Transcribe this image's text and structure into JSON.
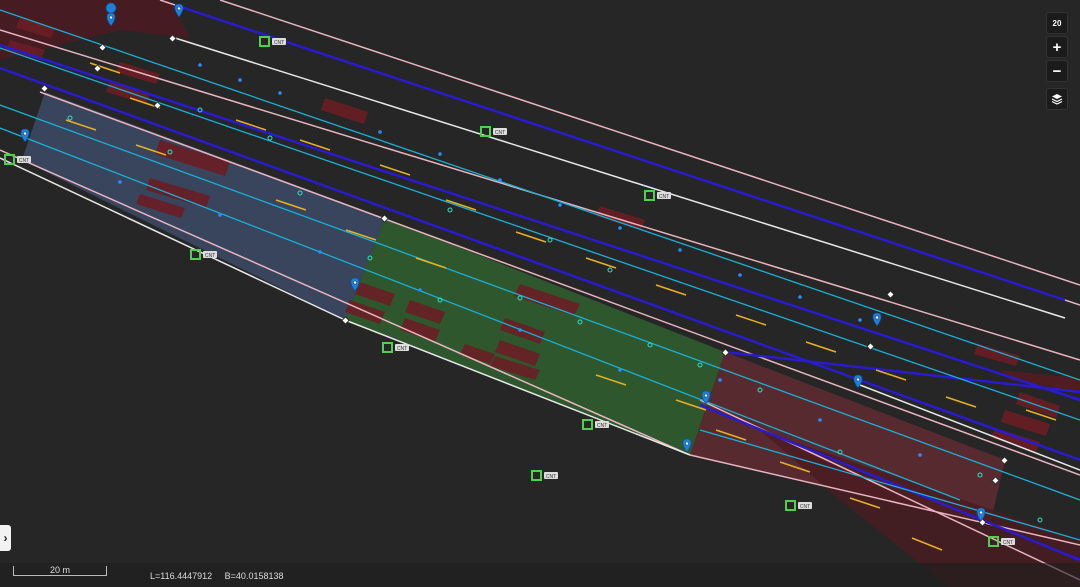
{
  "controls": {
    "zoom_level": "20",
    "zoom_in": "+",
    "zoom_out": "−",
    "expand": "›"
  },
  "scale": {
    "label": "20 m"
  },
  "coords": {
    "lng": "L=116.4447912",
    "lat": "B=40.0158138"
  },
  "sign_tag": "CNT",
  "colors": {
    "background": "#262626",
    "lane_edge": "#e8b4c0",
    "road_boundary": "#2a1ad0",
    "center_line": "#1ab0d8",
    "stop_segment": "#e8b020",
    "blue_region": "#3a4660",
    "green_region": "#2e5a2e",
    "red_region": "#5a2a30",
    "marker": "#1e7fd8"
  }
}
